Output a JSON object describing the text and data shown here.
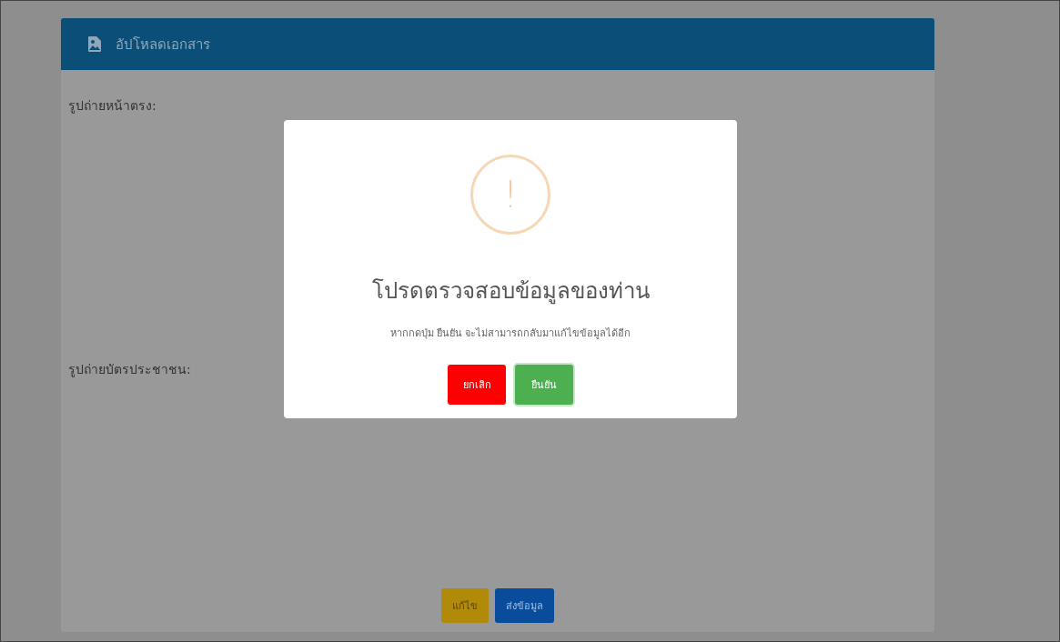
{
  "card": {
    "title": "อัปโหลดเอกสาร"
  },
  "fields": [
    {
      "label": "รูปถ่ายหน้าตรง:"
    },
    {
      "label": "รูปถ่ายบัตรประชาชน:"
    }
  ],
  "actions": [
    {
      "label": "แก้ไข",
      "kind": "warning"
    },
    {
      "label": "ส่งข้อมูล",
      "kind": "primary"
    }
  ],
  "dialog": {
    "icon": "!",
    "title": "โปรดตรวจสอบข้อมูลของท่าน",
    "message": "หากกดปุ่ม ยืนยัน จะไม่สามารถกลับมาแก้ไขข้อมูลได้อีก",
    "buttons": [
      {
        "label": "ยกเลิก",
        "kind": "cancel"
      },
      {
        "label": "ยืนยัน",
        "kind": "confirm"
      }
    ]
  }
}
